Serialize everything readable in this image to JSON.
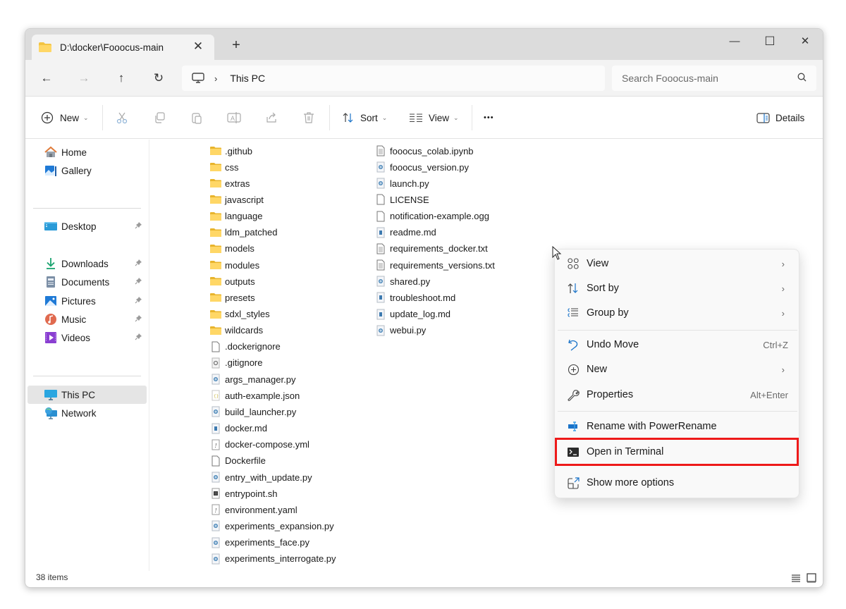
{
  "window": {
    "tab_title": "D:\\docker\\Fooocus-main",
    "tab_close": "✕",
    "new_tab": "+",
    "minimize": "—",
    "maximize": "☐",
    "close": "✕"
  },
  "nav": {
    "back": "←",
    "forward": "→",
    "up": "↑",
    "refresh": "↻",
    "breadcrumb_sep": "›",
    "breadcrumb": [
      "This PC"
    ],
    "search_placeholder": "Search Fooocus-main"
  },
  "toolbar": {
    "new_label": "New",
    "sort_label": "Sort",
    "view_label": "View",
    "more_label": "•••",
    "details_label": "Details",
    "chevron": "⌄",
    "icons": [
      "cut-icon",
      "copy-icon",
      "paste-icon",
      "rename-icon",
      "share-icon",
      "delete-icon"
    ]
  },
  "sidebar": {
    "items": [
      {
        "label": "Home",
        "icon": "home-icon",
        "pinned": false
      },
      {
        "label": "Gallery",
        "icon": "gallery-icon",
        "pinned": false
      },
      {
        "label": "Desktop",
        "icon": "desktop-icon",
        "pinned": true
      },
      {
        "label": "Downloads",
        "icon": "downloads-icon",
        "pinned": true
      },
      {
        "label": "Documents",
        "icon": "documents-icon",
        "pinned": true
      },
      {
        "label": "Pictures",
        "icon": "pictures-icon",
        "pinned": true
      },
      {
        "label": "Music",
        "icon": "music-icon",
        "pinned": true
      },
      {
        "label": "Videos",
        "icon": "videos-icon",
        "pinned": true
      },
      {
        "label": "This PC",
        "icon": "this-pc-icon",
        "pinned": false,
        "selected": true
      },
      {
        "label": "Network",
        "icon": "network-icon",
        "pinned": false
      }
    ],
    "pin_glyph": "📌"
  },
  "files": {
    "column1": [
      {
        "name": ".github",
        "type": "folder"
      },
      {
        "name": "css",
        "type": "folder"
      },
      {
        "name": "extras",
        "type": "folder"
      },
      {
        "name": "javascript",
        "type": "folder"
      },
      {
        "name": "language",
        "type": "folder"
      },
      {
        "name": "ldm_patched",
        "type": "folder"
      },
      {
        "name": "models",
        "type": "folder"
      },
      {
        "name": "modules",
        "type": "folder"
      },
      {
        "name": "outputs",
        "type": "folder"
      },
      {
        "name": "presets",
        "type": "folder"
      },
      {
        "name": "sdxl_styles",
        "type": "folder"
      },
      {
        "name": "wildcards",
        "type": "folder"
      },
      {
        "name": ".dockerignore",
        "type": "blank"
      },
      {
        "name": ".gitignore",
        "type": "config"
      },
      {
        "name": "args_manager.py",
        "type": "python"
      },
      {
        "name": "auth-example.json",
        "type": "json"
      },
      {
        "name": "build_launcher.py",
        "type": "python"
      },
      {
        "name": "docker.md",
        "type": "markdown"
      },
      {
        "name": "docker-compose.yml",
        "type": "yaml"
      },
      {
        "name": "Dockerfile",
        "type": "blank"
      },
      {
        "name": "entry_with_update.py",
        "type": "python"
      },
      {
        "name": "entrypoint.sh",
        "type": "shell"
      },
      {
        "name": "environment.yaml",
        "type": "yaml"
      },
      {
        "name": "experiments_expansion.py",
        "type": "python"
      },
      {
        "name": "experiments_face.py",
        "type": "python"
      },
      {
        "name": "experiments_interrogate.py",
        "type": "python"
      }
    ],
    "column2": [
      {
        "name": "fooocus_colab.ipynb",
        "type": "text"
      },
      {
        "name": "fooocus_version.py",
        "type": "python"
      },
      {
        "name": "launch.py",
        "type": "python"
      },
      {
        "name": "LICENSE",
        "type": "blank"
      },
      {
        "name": "notification-example.ogg",
        "type": "blank"
      },
      {
        "name": "readme.md",
        "type": "markdown"
      },
      {
        "name": "requirements_docker.txt",
        "type": "text"
      },
      {
        "name": "requirements_versions.txt",
        "type": "text"
      },
      {
        "name": "shared.py",
        "type": "python"
      },
      {
        "name": "troubleshoot.md",
        "type": "markdown"
      },
      {
        "name": "update_log.md",
        "type": "markdown"
      },
      {
        "name": "webui.py",
        "type": "python"
      }
    ]
  },
  "status": {
    "item_count": "38 items"
  },
  "context_menu": {
    "items": [
      {
        "label": "View",
        "icon": "view-grid-icon",
        "submenu": true
      },
      {
        "label": "Sort by",
        "icon": "sort-icon",
        "submenu": true
      },
      {
        "label": "Group by",
        "icon": "group-icon",
        "submenu": true
      },
      {
        "label": "Undo Move",
        "icon": "undo-icon",
        "shortcut": "Ctrl+Z"
      },
      {
        "label": "New",
        "icon": "new-icon",
        "submenu": true
      },
      {
        "label": "Properties",
        "icon": "wrench-icon",
        "shortcut": "Alt+Enter"
      },
      {
        "label": "Rename with PowerRename",
        "icon": "powerrename-icon"
      },
      {
        "label": "Open in Terminal",
        "icon": "terminal-icon",
        "highlighted": true
      },
      {
        "label": "Show more options",
        "icon": "show-more-icon"
      }
    ],
    "arrow": "›",
    "highlight_color": "#ee1a1a"
  }
}
